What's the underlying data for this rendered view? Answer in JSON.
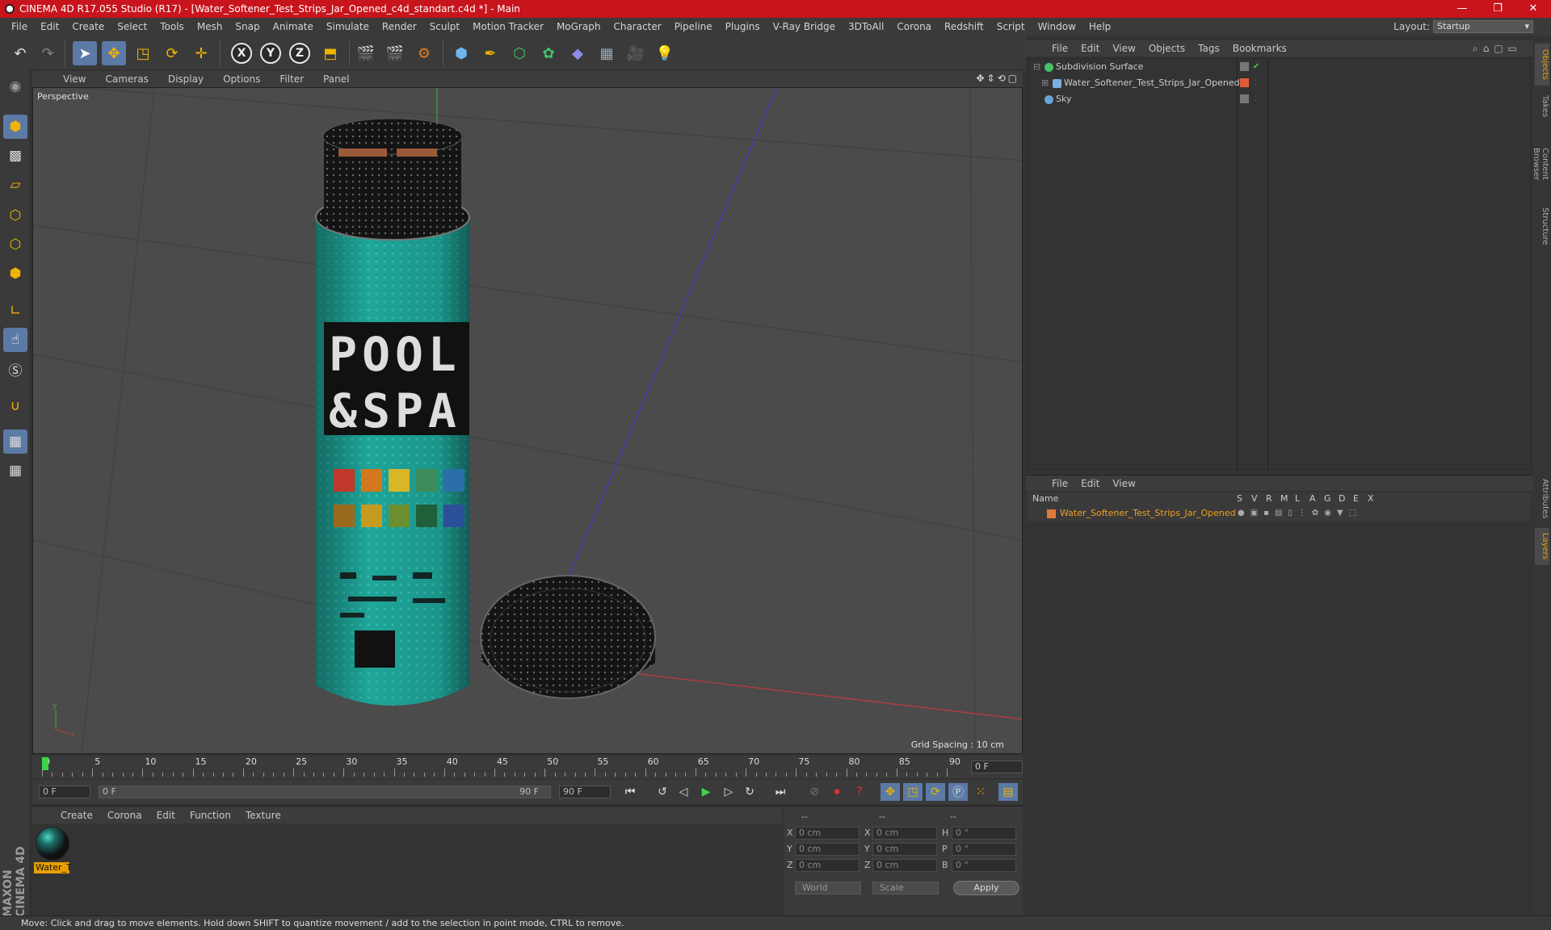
{
  "window": {
    "title": "CINEMA 4D R17.055 Studio (R17) - [Water_Softener_Test_Strips_Jar_Opened_c4d_standart.c4d *] - Main",
    "controls": [
      "—",
      "❐",
      "✕"
    ]
  },
  "menu": {
    "items": [
      "File",
      "Edit",
      "Create",
      "Select",
      "Tools",
      "Mesh",
      "Snap",
      "Animate",
      "Simulate",
      "Render",
      "Sculpt",
      "Motion Tracker",
      "MoGraph",
      "Character",
      "Pipeline",
      "Plugins",
      "V-Ray Bridge",
      "3DToAll",
      "Corona",
      "Redshift",
      "Script",
      "Window",
      "Help"
    ],
    "layout_label": "Layout:",
    "layout_value": "Startup"
  },
  "toolbar": {
    "icons": [
      "undo-icon",
      "redo-icon",
      "select-arrow-icon",
      "move-icon",
      "scale-icon",
      "rotate-icon",
      "live-move-icon",
      "x-axis-icon",
      "y-axis-icon",
      "z-axis-icon",
      "coordinate-system-icon",
      "render-view-icon",
      "render-picture-viewer-icon",
      "edit-render-settings-icon",
      "cube-icon",
      "pen-spline-icon",
      "subdivision-icon",
      "cloner-icon",
      "deformer-icon",
      "floor-icon",
      "camera-icon",
      "light-icon"
    ],
    "x_label": "X",
    "y_label": "Y",
    "z_label": "Z"
  },
  "viewport": {
    "menu": [
      "View",
      "Cameras",
      "Display",
      "Options",
      "Filter",
      "Panel"
    ],
    "label": "Perspective",
    "grid_spacing": "Grid Spacing : 10 cm",
    "jar_label_line1": "POOL",
    "jar_label_line2": "&SPA",
    "swatch_colors": [
      "#c0392b",
      "#d4781d",
      "#d9b528",
      "#3d8c5a",
      "#2a6fa8",
      "#9a6a1c",
      "#c69a1e",
      "#6b8f2f",
      "#1f5f3a",
      "#2c4f9a"
    ],
    "axis_colors": {
      "x": "#c43b3b",
      "y": "#39a845",
      "z": "#3a3ad0"
    }
  },
  "timeline": {
    "ticks": [
      "0",
      "5",
      "10",
      "15",
      "20",
      "25",
      "30",
      "35",
      "40",
      "45",
      "50",
      "55",
      "60",
      "65",
      "70",
      "75",
      "80",
      "85",
      "90"
    ],
    "current_frame": "0 F"
  },
  "transport": {
    "start_field": "0 F",
    "range_start": "0 F",
    "range_end": "90 F",
    "end_field": "90 F"
  },
  "material_manager": {
    "menu": [
      "Create",
      "Corona",
      "Edit",
      "Function",
      "Texture"
    ],
    "material_name": "Water_T"
  },
  "coordinates": {
    "header": [
      "--",
      "--",
      "--"
    ],
    "rows": [
      {
        "a": "X",
        "av": "0 cm",
        "b": "X",
        "bv": "0 cm",
        "c": "H",
        "cv": "0 °"
      },
      {
        "a": "Y",
        "av": "0 cm",
        "b": "Y",
        "bv": "0 cm",
        "c": "P",
        "cv": "0 °"
      },
      {
        "a": "Z",
        "av": "0 cm",
        "b": "Z",
        "bv": "0 cm",
        "c": "B",
        "cv": "0 °"
      }
    ],
    "mode_world": "World",
    "mode_scale": "Scale",
    "apply": "Apply"
  },
  "object_manager": {
    "menu": [
      "File",
      "Edit",
      "View",
      "Objects",
      "Tags",
      "Bookmarks"
    ],
    "objects": [
      {
        "name": "Subdivision Surface",
        "icon_color": "#44c36a"
      },
      {
        "name": "Water_Softener_Test_Strips_Jar_Opened",
        "icon_color": "#7ab0e0"
      },
      {
        "name": "Sky",
        "icon_color": "#6aa3d8"
      }
    ]
  },
  "layer_manager": {
    "menu": [
      "File",
      "Edit",
      "View"
    ],
    "columns": [
      "Name",
      "S",
      "V",
      "R",
      "M",
      "L",
      "A",
      "G",
      "D",
      "E",
      "X"
    ],
    "layer_name": "Water_Softener_Test_Strips_Jar_Opened",
    "layer_color": "#e07a3a"
  },
  "right_tabs": [
    "Objects",
    "Takes",
    "Content Browser",
    "Structure",
    "Attributes",
    "Layers"
  ],
  "brand": "MAXON CINEMA 4D",
  "status": "Move: Click and drag to move elements. Hold down SHIFT to quantize movement / add to the selection in point mode, CTRL to remove."
}
